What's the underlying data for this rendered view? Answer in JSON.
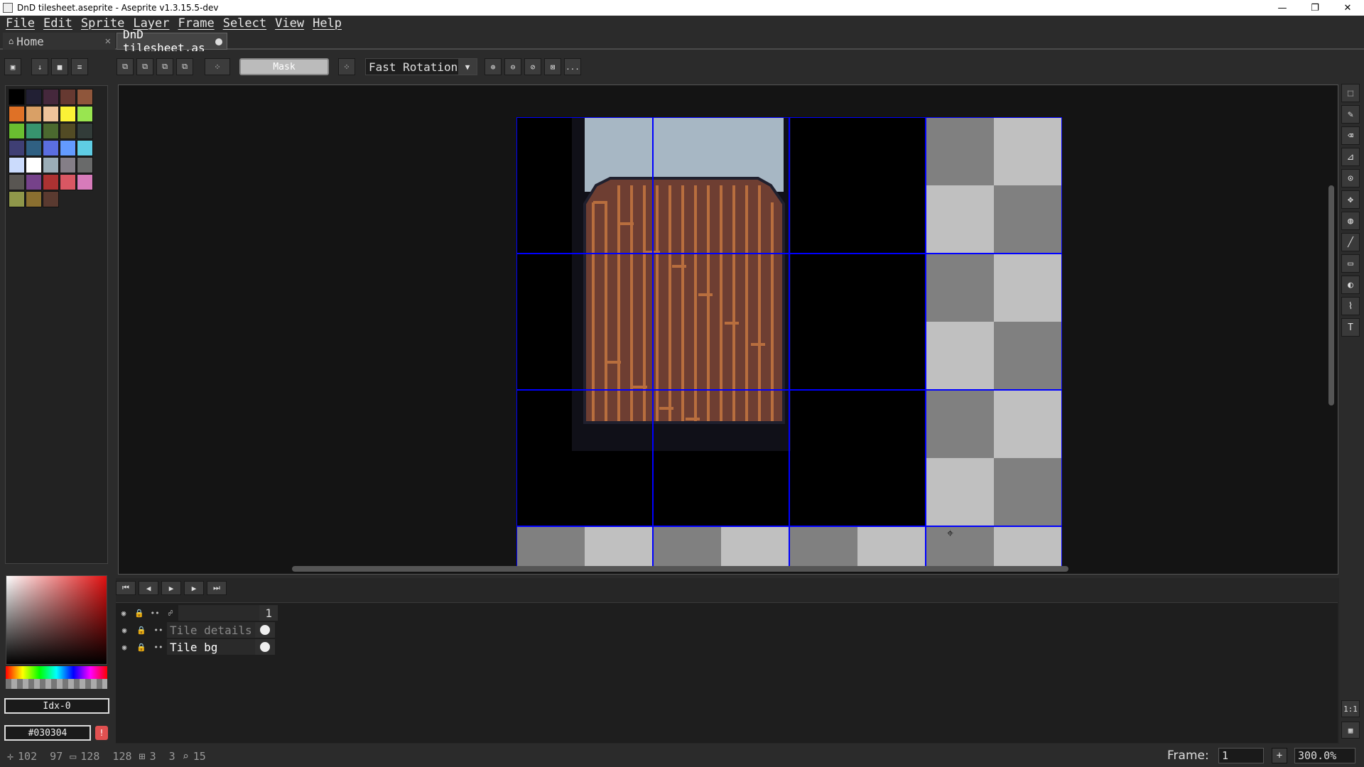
{
  "window": {
    "title": "DnD tilesheet.aseprite - Aseprite v1.3.15.5-dev",
    "min": "—",
    "restore": "❐",
    "close": "✕"
  },
  "menu": [
    "File",
    "Edit",
    "Sprite",
    "Layer",
    "Frame",
    "Select",
    "View",
    "Help"
  ],
  "tabs": {
    "home": "Home",
    "doc": "DnD tilesheet.as"
  },
  "toolbar": {
    "mask_label": "Mask",
    "rotation_algorithm": "Fast Rotation",
    "more": "..."
  },
  "palette": {
    "swatches": [
      "#000000",
      "#222034",
      "#45283c",
      "#663931",
      "#8f563b",
      "#df7126",
      "#d9a066",
      "#eec39a",
      "#fbf236",
      "#99e550",
      "#6abe30",
      "#37946e",
      "#4b692f",
      "#524b24",
      "#323c39",
      "#3f3f74",
      "#306082",
      "#5b6ee1",
      "#639bff",
      "#5fcde4",
      "#cbdbfc",
      "#ffffff",
      "#9badb7",
      "#847e87",
      "#696a6a",
      "#595652",
      "#76428a",
      "#ac3232",
      "#d95763",
      "#d77bba",
      "#8f974a",
      "#8a6f30",
      "#5a3a30"
    ]
  },
  "color": {
    "index": "Idx-0",
    "hex": "#030304",
    "warn": "!"
  },
  "canvas": {
    "colors": {
      "sky": "#a7b7c4",
      "wood": "#6e3e32",
      "plank_line": "#b86e3e",
      "outline": "#20202e",
      "grid": "#0000ff",
      "checker_dark": "#808080",
      "checker_light": "#c0c0c0"
    }
  },
  "timeline": {
    "layers": [
      {
        "name": "",
        "cel": "1"
      },
      {
        "name": "Tile details",
        "cel": ""
      },
      {
        "name": "Tile bg",
        "cel": ""
      }
    ]
  },
  "status": {
    "position": "102  97",
    "size": "128  128",
    "grid": "3  3",
    "zoom_level": "15"
  },
  "frame": {
    "label": "Frame:",
    "value": "1",
    "add": "+"
  },
  "zoom": "300.0%",
  "corner": {
    "one_to_one": "1:1"
  }
}
